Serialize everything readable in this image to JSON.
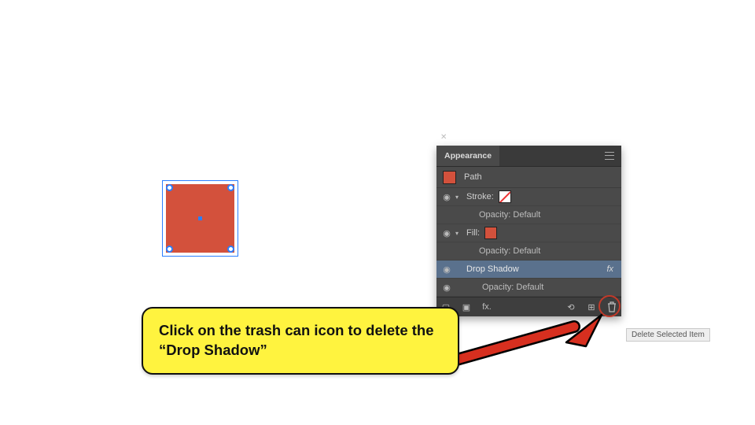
{
  "panel": {
    "title": "Appearance",
    "object_type": "Path",
    "rows": {
      "stroke_label": "Stroke:",
      "fill_label": "Fill:",
      "opacity_label": "Opacity:",
      "opacity_value": "Default",
      "drop_shadow_label": "Drop Shadow",
      "fx_indicator": "fx"
    },
    "footer": {
      "fx_label": "fx."
    }
  },
  "tooltip_text": "Delete Selected Item",
  "callout_text": "Click on the trash can icon to delete the “Drop Shadow”",
  "colors": {
    "shape_fill": "#d3513c",
    "selection": "#2b7fff",
    "callout_bg": "#fff33f",
    "arrow": "#d72f1f"
  }
}
